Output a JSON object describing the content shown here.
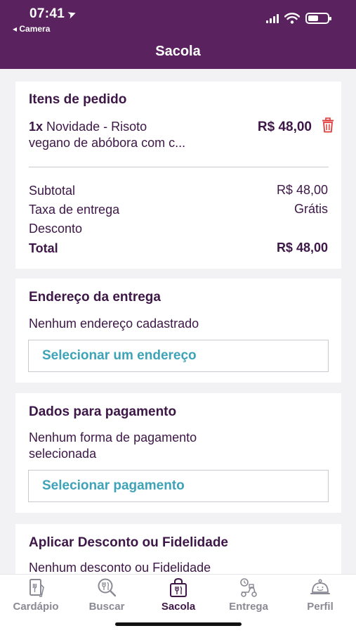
{
  "status_bar": {
    "time": "07:41",
    "back_app": "◂ Camera"
  },
  "header": {
    "title": "Sacola"
  },
  "order": {
    "title": "Itens de pedido",
    "item_qty": "1x",
    "item_name_line1": "Novidade  - Risoto",
    "item_name_line2": "vegano de abóbora com c...",
    "item_price": "R$ 48,00",
    "subtotal_label": "Subtotal",
    "subtotal_value": "R$ 48,00",
    "delivery_label": "Taxa de entrega",
    "delivery_value": "Grátis",
    "discount_label": "Desconto",
    "total_label": "Total",
    "total_value": "R$ 48,00"
  },
  "address": {
    "title": "Endereço da entrega",
    "empty_text": "Nenhum endereço cadastrado",
    "button_label": "Selecionar um endereço"
  },
  "payment": {
    "title": "Dados para pagamento",
    "empty_line1": "Nenhum forma de pagamento",
    "empty_line2": "selecionada",
    "button_label": "Selecionar pagamento"
  },
  "discount": {
    "title": "Aplicar Desconto ou Fidelidade",
    "empty_text": "Nenhum desconto ou Fidelidade"
  },
  "nav": [
    {
      "label": "Cardápio",
      "icon": "menu-book-icon",
      "active": false
    },
    {
      "label": "Buscar",
      "icon": "search-food-icon",
      "active": false
    },
    {
      "label": "Sacola",
      "icon": "bag-icon",
      "active": true
    },
    {
      "label": "Entrega",
      "icon": "delivery-scooter-icon",
      "active": false
    },
    {
      "label": "Perfil",
      "icon": "profile-cloche-icon",
      "active": false
    }
  ],
  "colors": {
    "header_bg": "#5b2260",
    "accent_link": "#3ea3b8",
    "delete_red": "#e03c3c",
    "text_dark": "#3d1747"
  }
}
